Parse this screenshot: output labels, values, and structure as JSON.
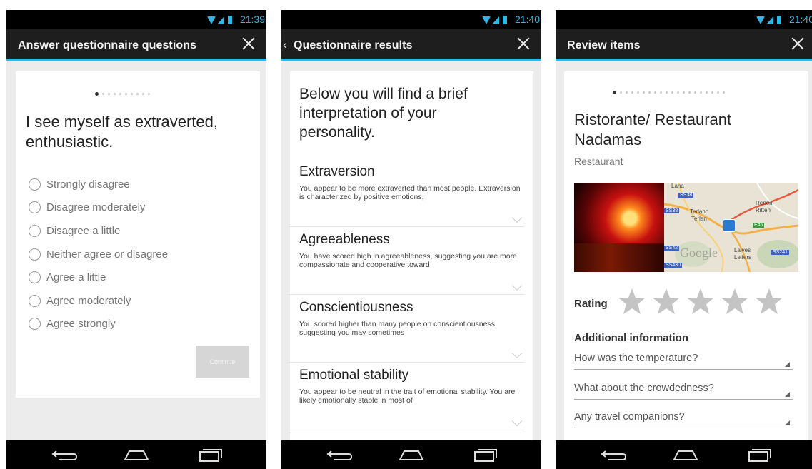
{
  "status": {
    "time_1": "21:39",
    "time_2": "21:40",
    "time_3": "21:40",
    "icons": [
      "wifi-icon",
      "signal-icon",
      "battery-icon"
    ],
    "accent_color": "#33b5e5"
  },
  "screen1": {
    "title": "Answer questionnaire questions",
    "question": "I see myself as extraverted, enthusiastic.",
    "options": [
      "Strongly disagree",
      "Disagree moderately",
      "Disagree a little",
      "Neither agree or disagree",
      "Agree a little",
      "Agree moderately",
      "Agree strongly"
    ],
    "continue_label": "Continue"
  },
  "screen2": {
    "back_glyph": "‹",
    "title": "Questionnaire results",
    "intro": "Below you will find a brief interpretation of your personality.",
    "traits": [
      {
        "name": "Extraversion",
        "desc": "You appear to be more extraverted than most people. Extraversion is characterized by positive emotions,"
      },
      {
        "name": "Agreeableness",
        "desc": "You have scored high in agreeableness, suggesting you are more compassionate and cooperative toward"
      },
      {
        "name": "Conscientiousness",
        "desc": "You scored higher than many people on conscientiousness, suggesting you may sometimes"
      },
      {
        "name": "Emotional stability",
        "desc": "You appear to be neutral in the trait of emotional stability. You are likely emotionally stable in most of"
      }
    ]
  },
  "screen3": {
    "title": "Review items",
    "place_name": "Ristorante/ Restaurant Nadamas",
    "place_type": "Restaurant",
    "map": {
      "labels": [
        "Lana",
        "Terlano",
        "Terlan",
        "Renon",
        "Ritten",
        "Laives",
        "Leifers"
      ],
      "roads": [
        "SS38",
        "SS38",
        "SS42",
        "SS430",
        "E45",
        "SS241"
      ],
      "watermark": "Google"
    },
    "rating_label": "Rating",
    "rating_stars": 0,
    "rating_max": 5,
    "additional_label": "Additional information",
    "questions": [
      "How was the temperature?",
      "What about the crowdedness?",
      "Any travel companions?"
    ]
  }
}
